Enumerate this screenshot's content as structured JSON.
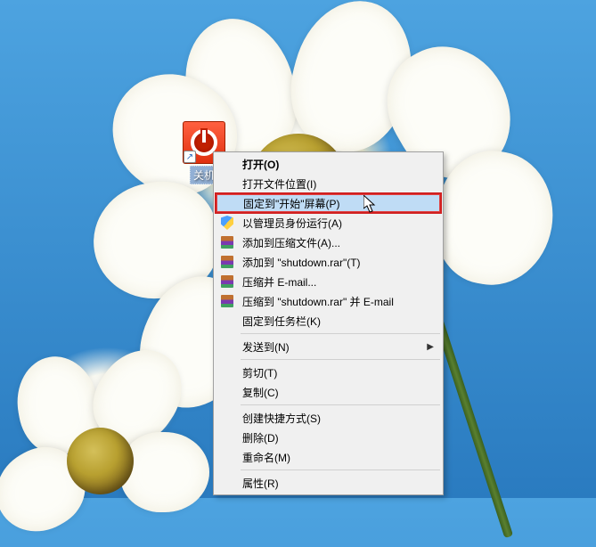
{
  "desktop": {
    "icon_label": "关机"
  },
  "context_menu": {
    "open": "打开(O)",
    "open_file_location": "打开文件位置(I)",
    "pin_to_start": "固定到\"开始\"屏幕(P)",
    "run_as_admin": "以管理员身份运行(A)",
    "add_to_archive": "添加到压缩文件(A)...",
    "add_to_shutdown_rar": "添加到 \"shutdown.rar\"(T)",
    "compress_email": "压缩并 E-mail...",
    "compress_to_rar_email": "压缩到 \"shutdown.rar\" 并 E-mail",
    "pin_to_taskbar": "固定到任务栏(K)",
    "send_to": "发送到(N)",
    "cut": "剪切(T)",
    "copy": "复制(C)",
    "create_shortcut": "创建快捷方式(S)",
    "delete": "删除(D)",
    "rename": "重命名(M)",
    "properties": "属性(R)"
  }
}
